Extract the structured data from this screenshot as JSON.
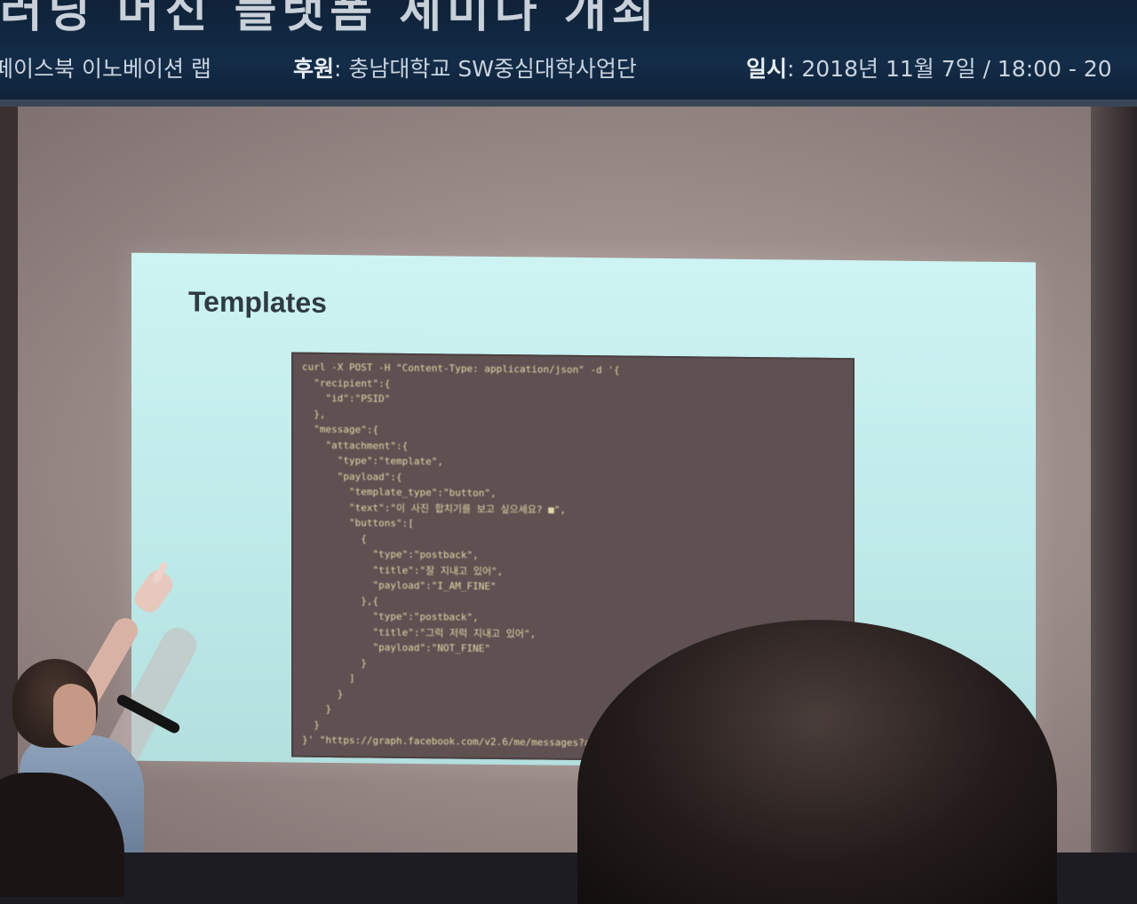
{
  "banner": {
    "title_fragment": "러닝 머신 플랫폼 세미나 개최",
    "host_text": "페이스북 이노베이션 랩",
    "sponsor_label": "후원",
    "sponsor_value": ": 충남대학교 SW중심대학사업단",
    "date_label": "일시",
    "date_value": ": 2018년 11월 7일 / 18:00 - 20"
  },
  "slide": {
    "title": "Templates",
    "code_lines": [
      "curl -X POST -H \"Content-Type: application/json\" -d '{",
      "  \"recipient\":{",
      "    \"id\":\"PSID\"",
      "  },",
      "  \"message\":{",
      "    \"attachment\":{",
      "      \"type\":\"template\",",
      "      \"payload\":{",
      "        \"template_type\":\"button\",",
      "        \"text\":\"이 사진 합치기를 보고 싶으세요? ■\",",
      "        \"buttons\":[",
      "          {",
      "            \"type\":\"postback\",",
      "            \"title\":\"잘 지내고 있어\",",
      "            \"payload\":\"I_AM_FINE\"",
      "          },{",
      "            \"type\":\"postback\",",
      "            \"title\":\"그럭 저럭 지내고 있어\",",
      "            \"payload\":\"NOT_FINE\"",
      "          }",
      "        ]",
      "      }",
      "    }",
      "  }",
      "}' \"https://graph.facebook.com/v2.6/me/messages?access_token=<PAGE_ACCESS_TOKEN>\""
    ]
  }
}
